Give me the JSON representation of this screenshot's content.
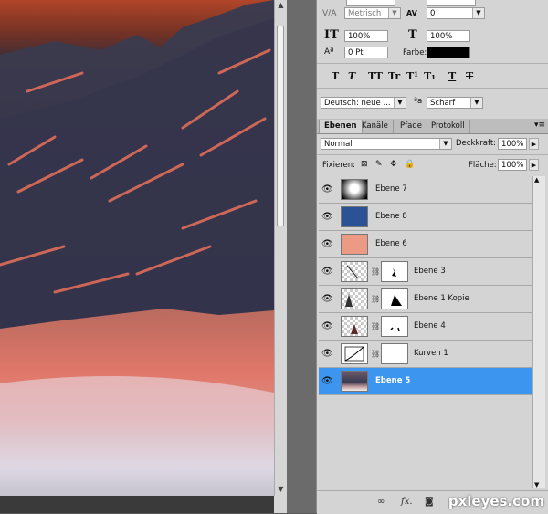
{
  "char_panel": {
    "tracking_unit": "Metrisch",
    "kerning_value": "0",
    "vscale": "100%",
    "hscale": "100%",
    "baseline": "0 Pt",
    "color_label": "Farbe:",
    "style_buttons": [
      "T",
      "T",
      "TT",
      "Tr",
      "T¹",
      "T₁",
      "T",
      "T"
    ],
    "language": "Deutsch: neue ...",
    "aa_label": "ªa",
    "antialias": "Scharf"
  },
  "layers_panel": {
    "tabs": [
      "Ebenen",
      "Kanäle",
      "Pfade",
      "Protokoll"
    ],
    "blend_mode": "Normal",
    "opacity_label": "Deckkraft:",
    "opacity": "100%",
    "lock_label": "Fixieren:",
    "fill_label": "Fläche:",
    "fill": "100%",
    "layers": [
      {
        "name": "Ebene 7",
        "thumb": "white-glow",
        "mask": false,
        "selected": false
      },
      {
        "name": "Ebene 8",
        "thumb": "#2b5294",
        "mask": false,
        "selected": false
      },
      {
        "name": "Ebene 6",
        "thumb": "#ec9a84",
        "mask": false,
        "selected": false
      },
      {
        "name": "Ebene 3",
        "thumb": "transparent",
        "mask": true,
        "selected": false
      },
      {
        "name": "Ebene 1 Kopie",
        "thumb": "transparent",
        "mask": true,
        "selected": false
      },
      {
        "name": "Ebene 4",
        "thumb": "transparent",
        "mask": true,
        "selected": false
      },
      {
        "name": "Kurven 1",
        "thumb": "curves",
        "mask": true,
        "selected": false
      },
      {
        "name": "Ebene 5",
        "thumb": "photo",
        "mask": false,
        "selected": true
      }
    ],
    "footer_icons": [
      "link-icon",
      "fx-icon",
      "mask-icon"
    ]
  },
  "watermark": "pxleyes.com",
  "colors": {
    "selection": "#3c95ef",
    "panel_bg": "#d4d4d4"
  }
}
